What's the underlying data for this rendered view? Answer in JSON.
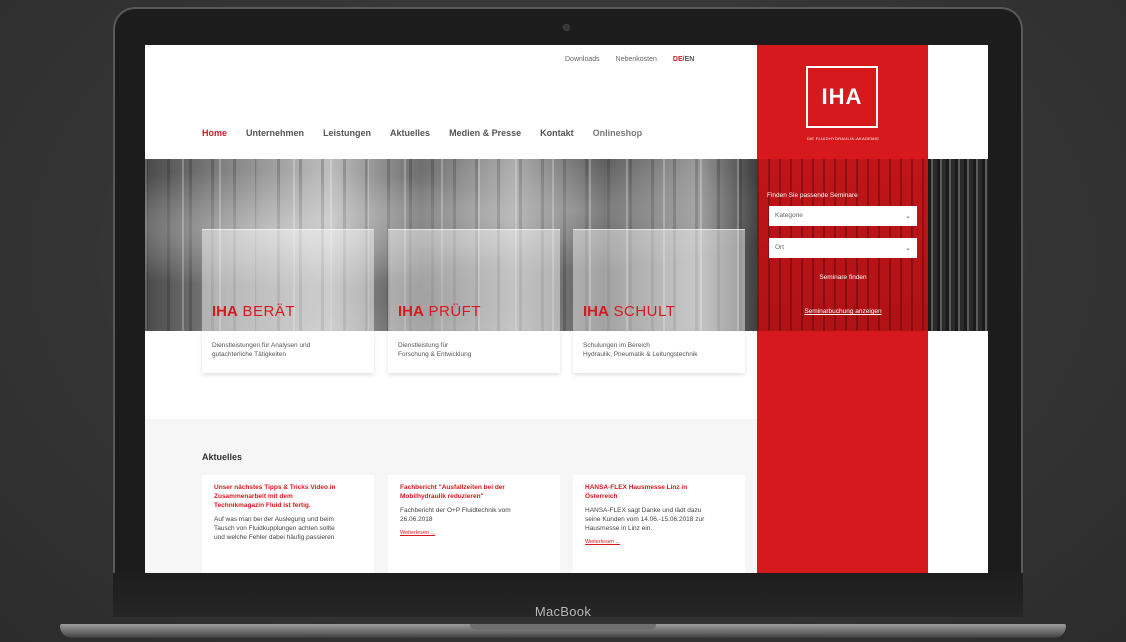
{
  "device": {
    "label": "MacBook"
  },
  "site": {
    "topbar": {
      "links": [
        "Downloads",
        "Nebenkosten"
      ],
      "lang_de": "DE",
      "lang_sep": "/",
      "lang_en": "EN"
    },
    "nav": [
      "Home",
      "Unternehmen",
      "Leistungen",
      "Aktuelles",
      "Medien & Presse",
      "Kontakt",
      "Onlineshop"
    ],
    "logo": {
      "text": "IHA",
      "subtitle": "DIE FLUIDHYDRAULIK-AKADEMIE"
    },
    "cards": [
      {
        "brand": "IHA",
        "word": "BERÄT",
        "lines": [
          "Dienstleistungen für Analysen und",
          "gutachterliche Tätigkeiten"
        ]
      },
      {
        "brand": "IHA",
        "word": "PRÜFT",
        "lines": [
          "Dienstleistung für",
          "Forschung & Entwicklung"
        ]
      },
      {
        "brand": "IHA",
        "word": "SCHULT",
        "lines": [
          "Schulungen im Bereich",
          "Hydraulik, Pneumatik & Leitungstechnik"
        ]
      }
    ],
    "finder": {
      "title": "Finden Sie passende Seminare",
      "category_placeholder": "Kategorie",
      "location_placeholder": "Ort",
      "button": "Seminare finden",
      "all_link": "Seminarbuchung anzeigen"
    },
    "news": {
      "heading": "Aktuelles",
      "items": [
        {
          "title": [
            "Unser nächstes Tipps & Tricks Video in",
            "Zusammenarbeit mit dem",
            "Technikmagazin Fluid ist fertig."
          ],
          "body": [
            "Auf was man bei der Auslegung und beim",
            "Tausch von Fluidkupplungen achten sollte",
            "und welche Fehler dabei häufig passieren"
          ],
          "more": ""
        },
        {
          "title": [
            "Fachbericht \"Ausfallzeiten bei der",
            "Mobilhydraulik reduzieren\""
          ],
          "body": [
            "Fachbericht der O+P Fluidtechnik vom",
            "26.06.2018"
          ],
          "more": "Weiterlesen ..."
        },
        {
          "title": [
            "HANSA-FLEX Hausmesse Linz in",
            "Österreich"
          ],
          "body": [
            "HANSA-FLEX sagt Danke und lädt dazu",
            "seine Kunden vom 14.06.-15.06.2018 zur",
            "Hausmesse in Linz ein."
          ],
          "more": "Weiterlesen ..."
        }
      ]
    }
  },
  "colors": {
    "brand_red": "#d7191e",
    "background": "#3a3a3a"
  }
}
